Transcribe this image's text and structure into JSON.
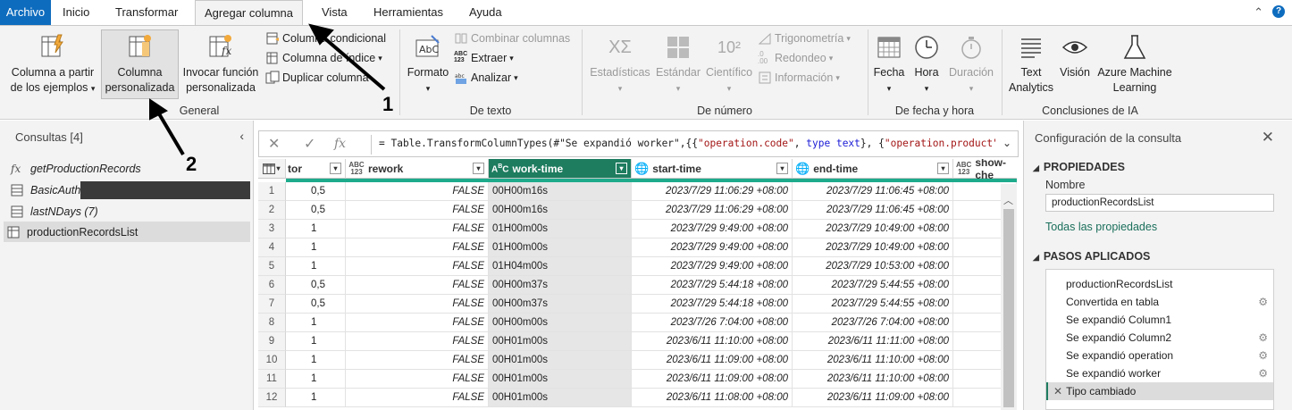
{
  "menu": {
    "file": "Archivo",
    "tabs": [
      "Inicio",
      "Transformar",
      "Agregar columna",
      "Vista",
      "Herramientas",
      "Ayuda"
    ],
    "active_tab": "Agregar columna"
  },
  "ribbon": {
    "general": {
      "label": "General",
      "col_from_examples_l1": "Columna a partir",
      "col_from_examples_l2": "de los ejemplos",
      "custom_col_l1": "Columna",
      "custom_col_l2": "personalizada",
      "invoke_fn_l1": "Invocar función",
      "invoke_fn_l2": "personalizada",
      "conditional": "Columna condicional",
      "index": "Columna de índice",
      "duplicate": "Duplicar columna"
    },
    "text": {
      "label": "De texto",
      "format": "Formato",
      "merge": "Combinar columnas",
      "extract": "Extraer",
      "parse": "Analizar"
    },
    "number": {
      "label": "De número",
      "statistics": "Estadísticas",
      "standard": "Estándar",
      "scientific": "Científico",
      "trig": "Trigonometría",
      "rounding": "Redondeo",
      "info": "Información"
    },
    "datetime": {
      "label": "De fecha y hora",
      "date": "Fecha",
      "time": "Hora",
      "duration": "Duración"
    },
    "ai": {
      "label": "Conclusiones de IA",
      "text_analytics_l1": "Text",
      "text_analytics_l2": "Analytics",
      "vision": "Visión",
      "azure_ml_l1": "Azure Machine",
      "azure_ml_l2": "Learning"
    }
  },
  "queries": {
    "title": "Consultas [4]",
    "items": [
      "getProductionRecords",
      "BasicAuth",
      "lastNDays (7)",
      "productionRecordsList"
    ]
  },
  "formula": {
    "prefix": "= Table.TransformColumnTypes(#\"Se expandió worker\",{{",
    "s1": "\"operation.code\"",
    "mid1": ", ",
    "kw1": "type",
    "mid2": " ",
    "kw2": "text",
    "mid3": "}, {",
    "s2": "\"operation.product\"",
    "suffix": ","
  },
  "grid": {
    "headers": {
      "factor": "tor",
      "rework_type": "ABC 123",
      "rework": "rework",
      "worktime": "work-time",
      "start": "start-time",
      "end": "end-time",
      "show_type": "ABC 123",
      "show": "show-che"
    },
    "rows": [
      {
        "n": "1",
        "factor": "0,5",
        "rework": "FALSE",
        "wt": "00H00m16s",
        "start": "2023/7/29 11:06:29 +08:00",
        "end": "2023/7/29 11:06:45 +08:00"
      },
      {
        "n": "2",
        "factor": "0,5",
        "rework": "FALSE",
        "wt": "00H00m16s",
        "start": "2023/7/29 11:06:29 +08:00",
        "end": "2023/7/29 11:06:45 +08:00"
      },
      {
        "n": "3",
        "factor": "1",
        "rework": "FALSE",
        "wt": "01H00m00s",
        "start": "2023/7/29 9:49:00 +08:00",
        "end": "2023/7/29 10:49:00 +08:00"
      },
      {
        "n": "4",
        "factor": "1",
        "rework": "FALSE",
        "wt": "01H00m00s",
        "start": "2023/7/29 9:49:00 +08:00",
        "end": "2023/7/29 10:49:00 +08:00"
      },
      {
        "n": "5",
        "factor": "1",
        "rework": "FALSE",
        "wt": "01H04m00s",
        "start": "2023/7/29 9:49:00 +08:00",
        "end": "2023/7/29 10:53:00 +08:00"
      },
      {
        "n": "6",
        "factor": "0,5",
        "rework": "FALSE",
        "wt": "00H00m37s",
        "start": "2023/7/29 5:44:18 +08:00",
        "end": "2023/7/29 5:44:55 +08:00"
      },
      {
        "n": "7",
        "factor": "0,5",
        "rework": "FALSE",
        "wt": "00H00m37s",
        "start": "2023/7/29 5:44:18 +08:00",
        "end": "2023/7/29 5:44:55 +08:00"
      },
      {
        "n": "8",
        "factor": "1",
        "rework": "FALSE",
        "wt": "00H00m00s",
        "start": "2023/7/26 7:04:00 +08:00",
        "end": "2023/7/26 7:04:00 +08:00"
      },
      {
        "n": "9",
        "factor": "1",
        "rework": "FALSE",
        "wt": "00H01m00s",
        "start": "2023/6/11 11:10:00 +08:00",
        "end": "2023/6/11 11:11:00 +08:00"
      },
      {
        "n": "10",
        "factor": "1",
        "rework": "FALSE",
        "wt": "00H01m00s",
        "start": "2023/6/11 11:09:00 +08:00",
        "end": "2023/6/11 11:10:00 +08:00"
      },
      {
        "n": "11",
        "factor": "1",
        "rework": "FALSE",
        "wt": "00H01m00s",
        "start": "2023/6/11 11:09:00 +08:00",
        "end": "2023/6/11 11:10:00 +08:00"
      },
      {
        "n": "12",
        "factor": "1",
        "rework": "FALSE",
        "wt": "00H01m00s",
        "start": "2023/6/11 11:08:00 +08:00",
        "end": "2023/6/11 11:09:00 +08:00"
      }
    ]
  },
  "settings": {
    "title": "Configuración de la consulta",
    "properties": "PROPIEDADES",
    "name_label": "Nombre",
    "name_value": "productionRecordsList",
    "all_props": "Todas las propiedades",
    "applied_steps": "PASOS APLICADOS",
    "steps": [
      {
        "label": "productionRecordsList",
        "gear": false
      },
      {
        "label": "Convertida en tabla",
        "gear": true
      },
      {
        "label": "Se expandió Column1",
        "gear": false
      },
      {
        "label": "Se expandió Column2",
        "gear": true
      },
      {
        "label": "Se expandió operation",
        "gear": true
      },
      {
        "label": "Se expandió worker",
        "gear": true
      },
      {
        "label": "Tipo cambiado",
        "gear": false
      }
    ]
  },
  "annotations": {
    "one": "1",
    "two": "2"
  },
  "colors": {
    "accent": "#0e6cbe",
    "selected_column": "#1e7c5f",
    "header_bar": "#1eab8c"
  }
}
